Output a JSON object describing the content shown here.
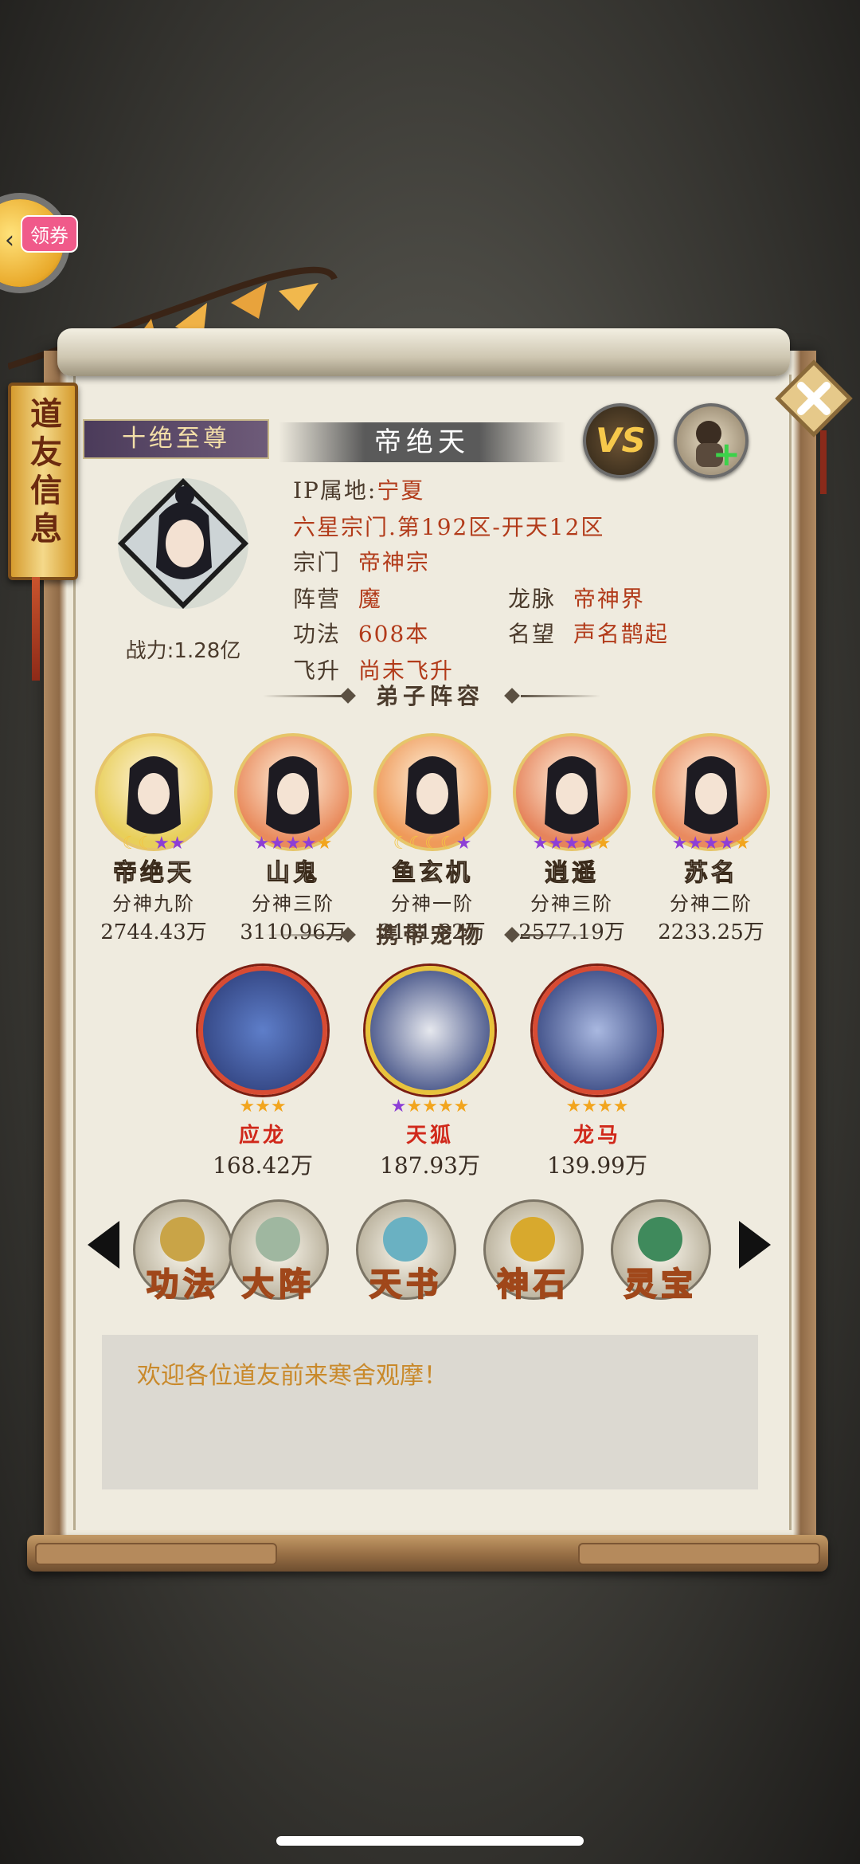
{
  "coupon": {
    "label": "领券"
  },
  "side_tab": {
    "label": "道友信息"
  },
  "header": {
    "rank_title": "十绝至尊",
    "player_name": "帝绝天",
    "vs_label": "VS"
  },
  "profile": {
    "power_label": "战力:1.28亿",
    "ip_label": "IP属地:",
    "ip_value": "宁夏",
    "sect_server": "六星宗门.第192区-开天12区",
    "sect_label": "宗门",
    "sect_value": "帝神宗",
    "camp_label": "阵营",
    "camp_value": "魔",
    "vein_label": "龙脉",
    "vein_value": "帝神界",
    "skill_label": "功法",
    "skill_value": "608本",
    "fame_label": "名望",
    "fame_value": "声名鹊起",
    "ascend_label": "飞升",
    "ascend_value": "尚未飞升"
  },
  "sections": {
    "disciples": "弟子阵容",
    "pets": "携带宠物"
  },
  "disciples": [
    {
      "name": "帝绝天",
      "rank": "分神九阶",
      "power": "2744.43万",
      "bg": "#e8cf5a",
      "stars": [
        "moon",
        "moon",
        "purple",
        "purple"
      ]
    },
    {
      "name": "山鬼",
      "rank": "分神三阶",
      "power": "3110.96万",
      "bg": "#e98b5d",
      "stars": [
        "purple",
        "purple",
        "purple",
        "purple",
        "gold"
      ]
    },
    {
      "name": "鱼玄机",
      "rank": "分神一阶",
      "power": "2161.82万",
      "bg": "#ef9a5a",
      "stars": [
        "moon",
        "moon",
        "moon",
        "moon",
        "purple"
      ]
    },
    {
      "name": "逍遥",
      "rank": "分神三阶",
      "power": "2577.19万",
      "bg": "#e6845c",
      "stars": [
        "purple",
        "purple",
        "purple",
        "purple",
        "gold"
      ]
    },
    {
      "name": "苏名",
      "rank": "分神二阶",
      "power": "2233.25万",
      "bg": "#e98a5f",
      "stars": [
        "purple",
        "purple",
        "purple",
        "purple",
        "gold"
      ]
    }
  ],
  "pets": [
    {
      "name": "应龙",
      "power": "168.42万",
      "ring": "#d84b33",
      "inner": "#5e7ec9",
      "stars": [
        "gold",
        "gold",
        "gold"
      ]
    },
    {
      "name": "天狐",
      "power": "187.93万",
      "ring": "#e8c33c",
      "inner": "#e6e8ee",
      "stars": [
        "purple",
        "gold",
        "gold",
        "gold",
        "gold"
      ]
    },
    {
      "name": "龙马",
      "power": "139.99万",
      "ring": "#d84b33",
      "inner": "#a9b8e0",
      "stars": [
        "gold",
        "gold",
        "gold",
        "gold"
      ]
    }
  ],
  "skills": [
    {
      "label": "功法",
      "icon": "#c9a447"
    },
    {
      "label": "大阵",
      "icon": "#9fb7a0"
    },
    {
      "label": "天书",
      "icon": "#6ab1c2"
    },
    {
      "label": "神石",
      "icon": "#d8a92d"
    },
    {
      "label": "灵宝",
      "icon": "#3f8a5c"
    }
  ],
  "message": {
    "text": "欢迎各位道友前来寒舍观摩！"
  },
  "colors": {
    "value_red": "#b23b1a",
    "star_gold": "#f2a51e",
    "star_purple": "#8d3fd6",
    "moon": "#f3c543"
  }
}
